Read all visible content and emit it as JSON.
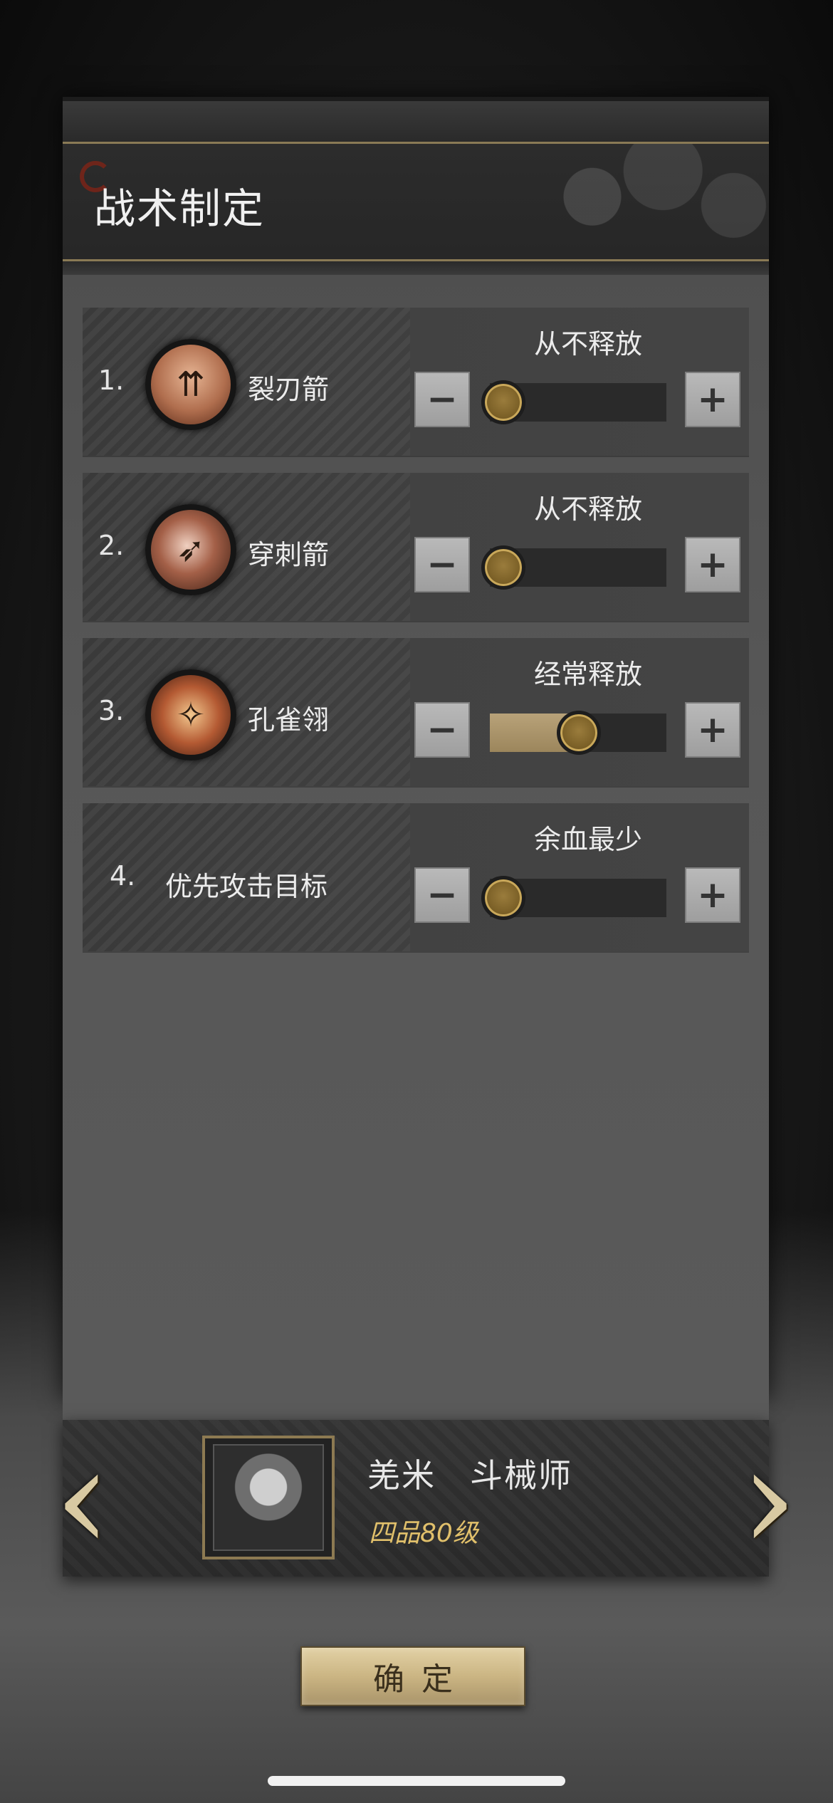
{
  "title": "战术制定",
  "rows": [
    {
      "number": "1.",
      "name": "裂刃箭",
      "icon": "split-blade-arrow-icon",
      "status": "从不释放",
      "level": 0.0
    },
    {
      "number": "2.",
      "name": "穿刺箭",
      "icon": "piercing-arrow-icon",
      "status": "从不释放",
      "level": 0.0
    },
    {
      "number": "3.",
      "name": "孔雀翎",
      "icon": "peacock-feather-icon",
      "status": "经常释放",
      "level": 0.5
    },
    {
      "number": "4.",
      "name": "优先攻击目标",
      "status": "余血最少",
      "level": 0.0
    }
  ],
  "controls": {
    "minus": "−",
    "plus": "+"
  },
  "hero": {
    "name": "羌米　斗械师",
    "rank": "四品80级",
    "portrait": "hero-portrait"
  },
  "nav": {
    "prev": "‹",
    "next": "›"
  },
  "confirm": "确定",
  "colors": {
    "accent_gold": "#e1c06b",
    "slider_fill": "#b8a279",
    "panel": "#4d4d4d"
  }
}
